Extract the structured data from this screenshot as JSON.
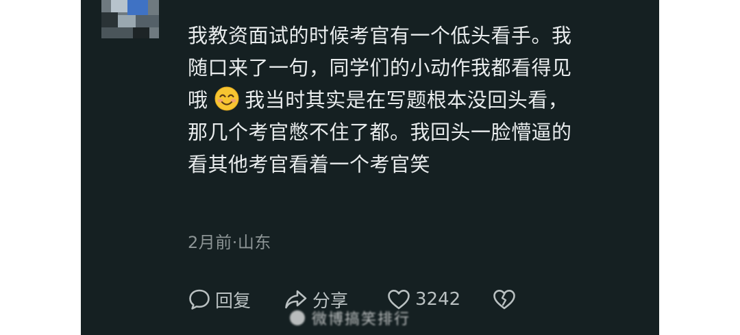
{
  "comment": {
    "lines": [
      "我教资面试的时候考官有一个低头看手。我",
      "随口来了一句，同学们的小动作我都看得见",
      "我当时其实是在写题根本没回头看，",
      "那几个考官憋不住了都。我回头一脸懵逼的",
      "看其他考官看着一个考官笑"
    ],
    "line3_prefix": "哦",
    "emoji_icon": "smiling-face-icon"
  },
  "meta": {
    "time_location": "2月前·山东"
  },
  "actions": {
    "reply_label": "回复",
    "share_label": "分享",
    "like_count": "3242",
    "dislike_icon": "broken-heart-icon"
  },
  "watermark": {
    "text": "微博搞笑排行"
  },
  "colors": {
    "background": "#152022",
    "text": "#e9eced",
    "meta": "#8d9596",
    "action": "#b9c0c1"
  }
}
